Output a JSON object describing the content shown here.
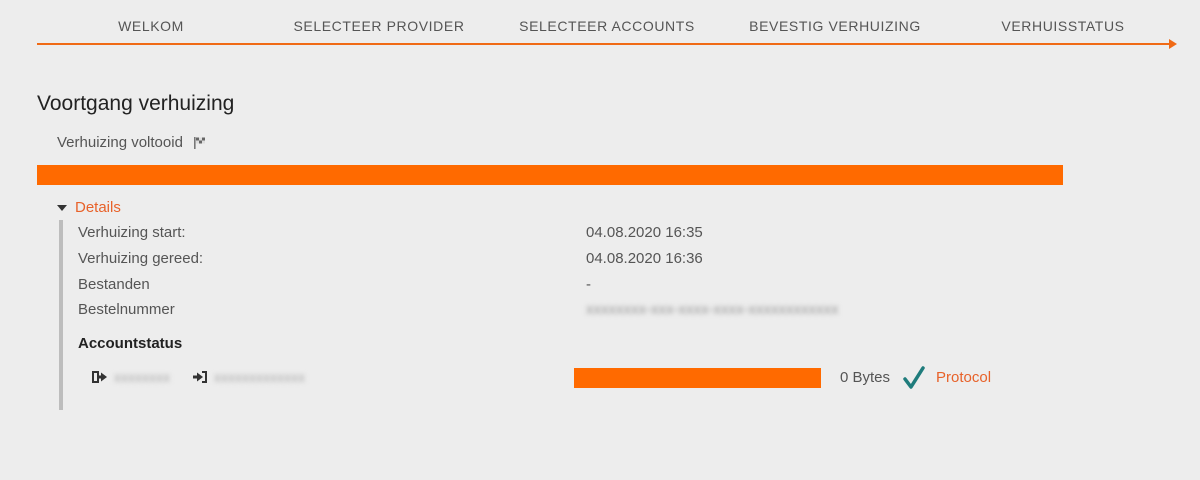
{
  "wizard": {
    "steps": [
      {
        "label": "WELKOM"
      },
      {
        "label": "SELECTEER PROVIDER"
      },
      {
        "label": "SELECTEER ACCOUNTS"
      },
      {
        "label": "BEVESTIG VERHUIZING"
      },
      {
        "label": "VERHUISSTATUS"
      }
    ]
  },
  "page": {
    "title": "Voortgang verhuizing",
    "status_text": "Verhuizing voltooid",
    "status_icon": "checkered-flag-icon",
    "progress_percent": 100,
    "accent_color": "#ff6a00"
  },
  "details": {
    "toggle_label": "Details",
    "rows": [
      {
        "label": "Verhuizing start:",
        "value": "04.08.2020 16:35"
      },
      {
        "label": "Verhuizing gereed:",
        "value": "04.08.2020 16:36"
      },
      {
        "label": "Bestanden",
        "value": "-"
      },
      {
        "label": "Bestelnummer",
        "value": "xxxxxxxx-xxx-xxxx-xxxx-xxxxxxxxxxxx"
      }
    ],
    "accounts_heading": "Accountstatus",
    "accounts": [
      {
        "source_icon": "sign-out-icon",
        "source_name": "xxxxxxxx",
        "target_icon": "sign-in-icon",
        "target_name": "xxxxxxxxxxxxx",
        "progress_percent": 100,
        "bytes": "0 Bytes",
        "status_icon": "check-icon",
        "link_label": "Protocol"
      }
    ]
  }
}
